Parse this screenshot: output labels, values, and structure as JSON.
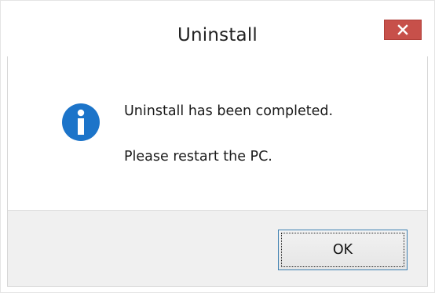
{
  "window": {
    "title": "Uninstall"
  },
  "titlebar": {
    "close_icon": "close-icon",
    "close_color": "#c7504a"
  },
  "message": {
    "icon": "info-icon",
    "icon_color": "#1c74c9",
    "line1": "Uninstall has been completed.",
    "line2": "Please restart the PC."
  },
  "buttons": {
    "ok_label": "OK"
  }
}
